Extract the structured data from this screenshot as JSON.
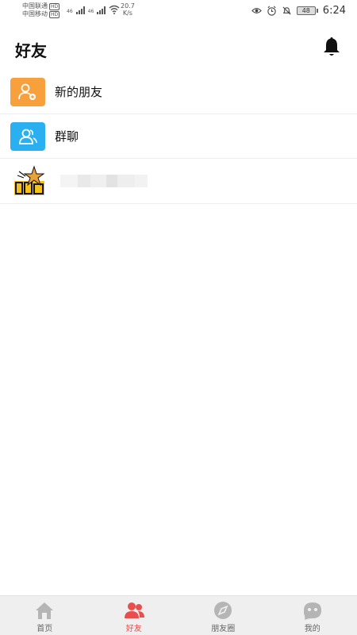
{
  "status_bar": {
    "carrier1": "中国联通",
    "carrier2": "中国移动",
    "hd": "HD",
    "net": "46",
    "speed_value": "20.7",
    "speed_unit": "K/s",
    "battery": "48",
    "time": "6:24"
  },
  "header": {
    "title": "好友"
  },
  "list": {
    "items": [
      {
        "label": "新的朋友",
        "icon": "add-user-icon",
        "color": "#f7a03c"
      },
      {
        "label": "群聊",
        "icon": "group-icon",
        "color": "#2ab0f0"
      }
    ]
  },
  "tabbar": {
    "tabs": [
      {
        "label": "首页",
        "icon": "home-icon",
        "active": false
      },
      {
        "label": "好友",
        "icon": "friends-icon",
        "active": true
      },
      {
        "label": "朋友圈",
        "icon": "compass-icon",
        "active": false
      },
      {
        "label": "我的",
        "icon": "profile-icon",
        "active": false
      }
    ]
  },
  "colors": {
    "accent": "#e94e4e",
    "tab_inactive": "#b5b5b5"
  }
}
